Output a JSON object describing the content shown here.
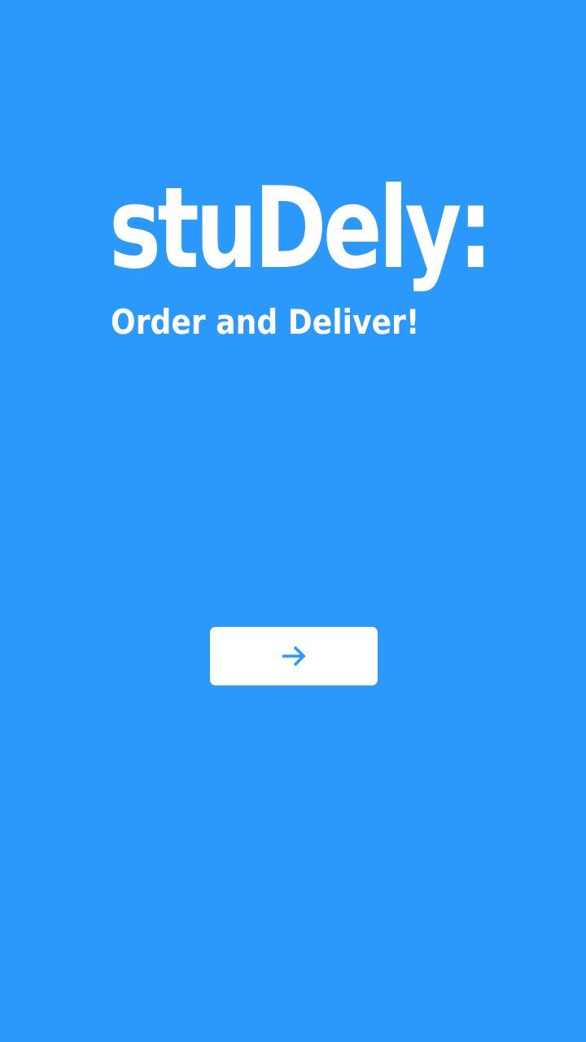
{
  "brand": {
    "app_name": "stuDely:",
    "tagline": "Order and Deliver!"
  },
  "actions": {
    "next_button_icon": "arrow-right-icon"
  },
  "colors": {
    "background": "#2a99fb",
    "foreground": "#ffffff",
    "button_background": "#ffffff",
    "button_icon": "#2a99fb"
  }
}
